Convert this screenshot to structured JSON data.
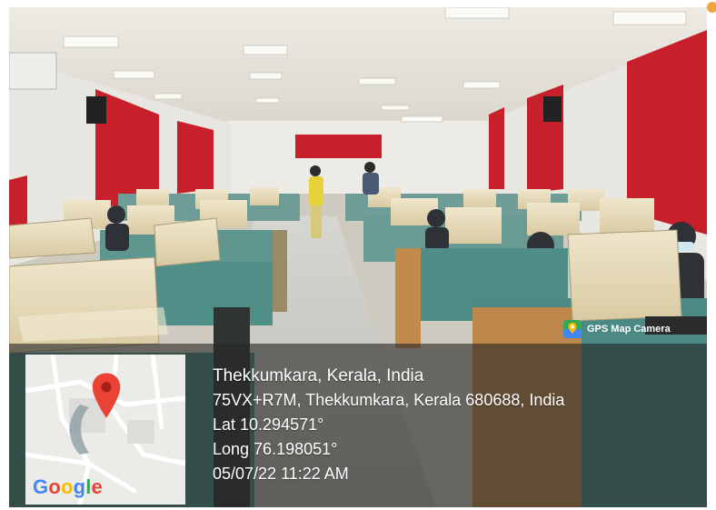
{
  "badge": {
    "label": "GPS Map Camera",
    "icon": "map-pin-camera-icon"
  },
  "map": {
    "logo_text": "Google",
    "logo_colors": [
      "#4285F4",
      "#EA4335",
      "#FBBC05",
      "#4285F4",
      "#34A853",
      "#EA4335"
    ],
    "pin_color": "#EA4335"
  },
  "location": {
    "place": "Thekkumkara, Kerala, India",
    "address": "75VX+R7M, Thekkumkara, Kerala 680688, India",
    "lat": "Lat 10.294571°",
    "long": "Long 76.198051°",
    "datetime": "05/07/22 11:22 AM"
  },
  "colors": {
    "wall_red": "#c8202a",
    "overlay": "#282826",
    "badge_dot": "#f2a33a"
  }
}
